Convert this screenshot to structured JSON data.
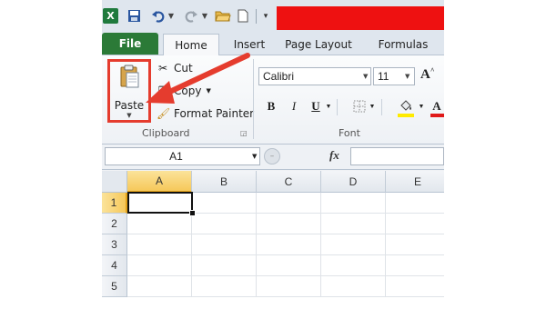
{
  "qat": {
    "excel_logo": "X",
    "icons": [
      "excel-icon",
      "save-icon",
      "undo-icon",
      "redo-icon",
      "open-folder-icon",
      "new-document-icon",
      "customize-icon"
    ]
  },
  "tabs": [
    {
      "label": "File"
    },
    {
      "label": "Home"
    },
    {
      "label": "Insert"
    },
    {
      "label": "Page Layout"
    },
    {
      "label": "Formulas"
    }
  ],
  "clipboard": {
    "paste_label": "Paste",
    "cut_label": "Cut",
    "copy_label": "Copy",
    "format_painter_label": "Format Painter",
    "group_label": "Clipboard"
  },
  "font": {
    "group_label": "Font",
    "name": "Calibri",
    "size": "11",
    "bold": "B",
    "italic": "I",
    "underline": "U",
    "grow": "A",
    "font_color": "A"
  },
  "formula_bar": {
    "name_box": "A1",
    "fx": "fx",
    "value": ""
  },
  "grid": {
    "columns": [
      "A",
      "B",
      "C",
      "D",
      "E"
    ],
    "rows": [
      "1",
      "2",
      "3",
      "4",
      "5"
    ],
    "active_cell": "A1"
  },
  "colors": {
    "file_tab": "#2b7a37",
    "annotation": "#e53c2e",
    "redaction": "#ee1111",
    "selection_header": "#f6c85a"
  }
}
